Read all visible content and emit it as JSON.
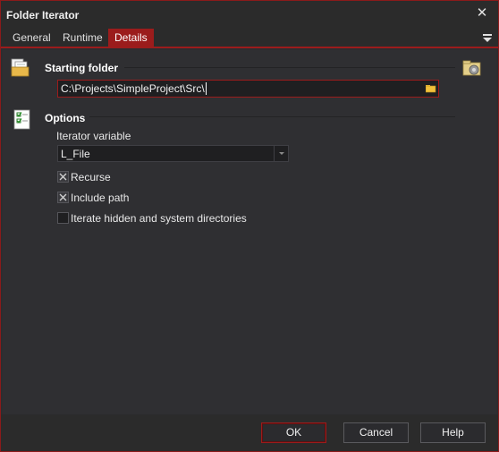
{
  "window": {
    "title": "Folder Iterator"
  },
  "tabs": [
    {
      "label": "General",
      "active": false
    },
    {
      "label": "Runtime",
      "active": false
    },
    {
      "label": "Details",
      "active": true
    }
  ],
  "starting_folder": {
    "title": "Starting folder",
    "path_value": "C:\\Projects\\SimpleProject\\Src\\",
    "icon": "folder-documents-icon",
    "gear_icon": "folder-gear-icon"
  },
  "options": {
    "title": "Options",
    "icon": "checklist-icon",
    "iterator_label": "Iterator variable",
    "iterator_value": "L_File",
    "checkboxes": [
      {
        "label": "Recurse",
        "checked": true
      },
      {
        "label": "Include path",
        "checked": true
      },
      {
        "label": "Iterate hidden and system directories",
        "checked": false
      }
    ]
  },
  "footer": {
    "ok": "OK",
    "cancel": "Cancel",
    "help": "Help"
  },
  "colors": {
    "accent": "#9b1c1c",
    "background": "#2f2f32",
    "input_bg": "#1f1f21"
  }
}
